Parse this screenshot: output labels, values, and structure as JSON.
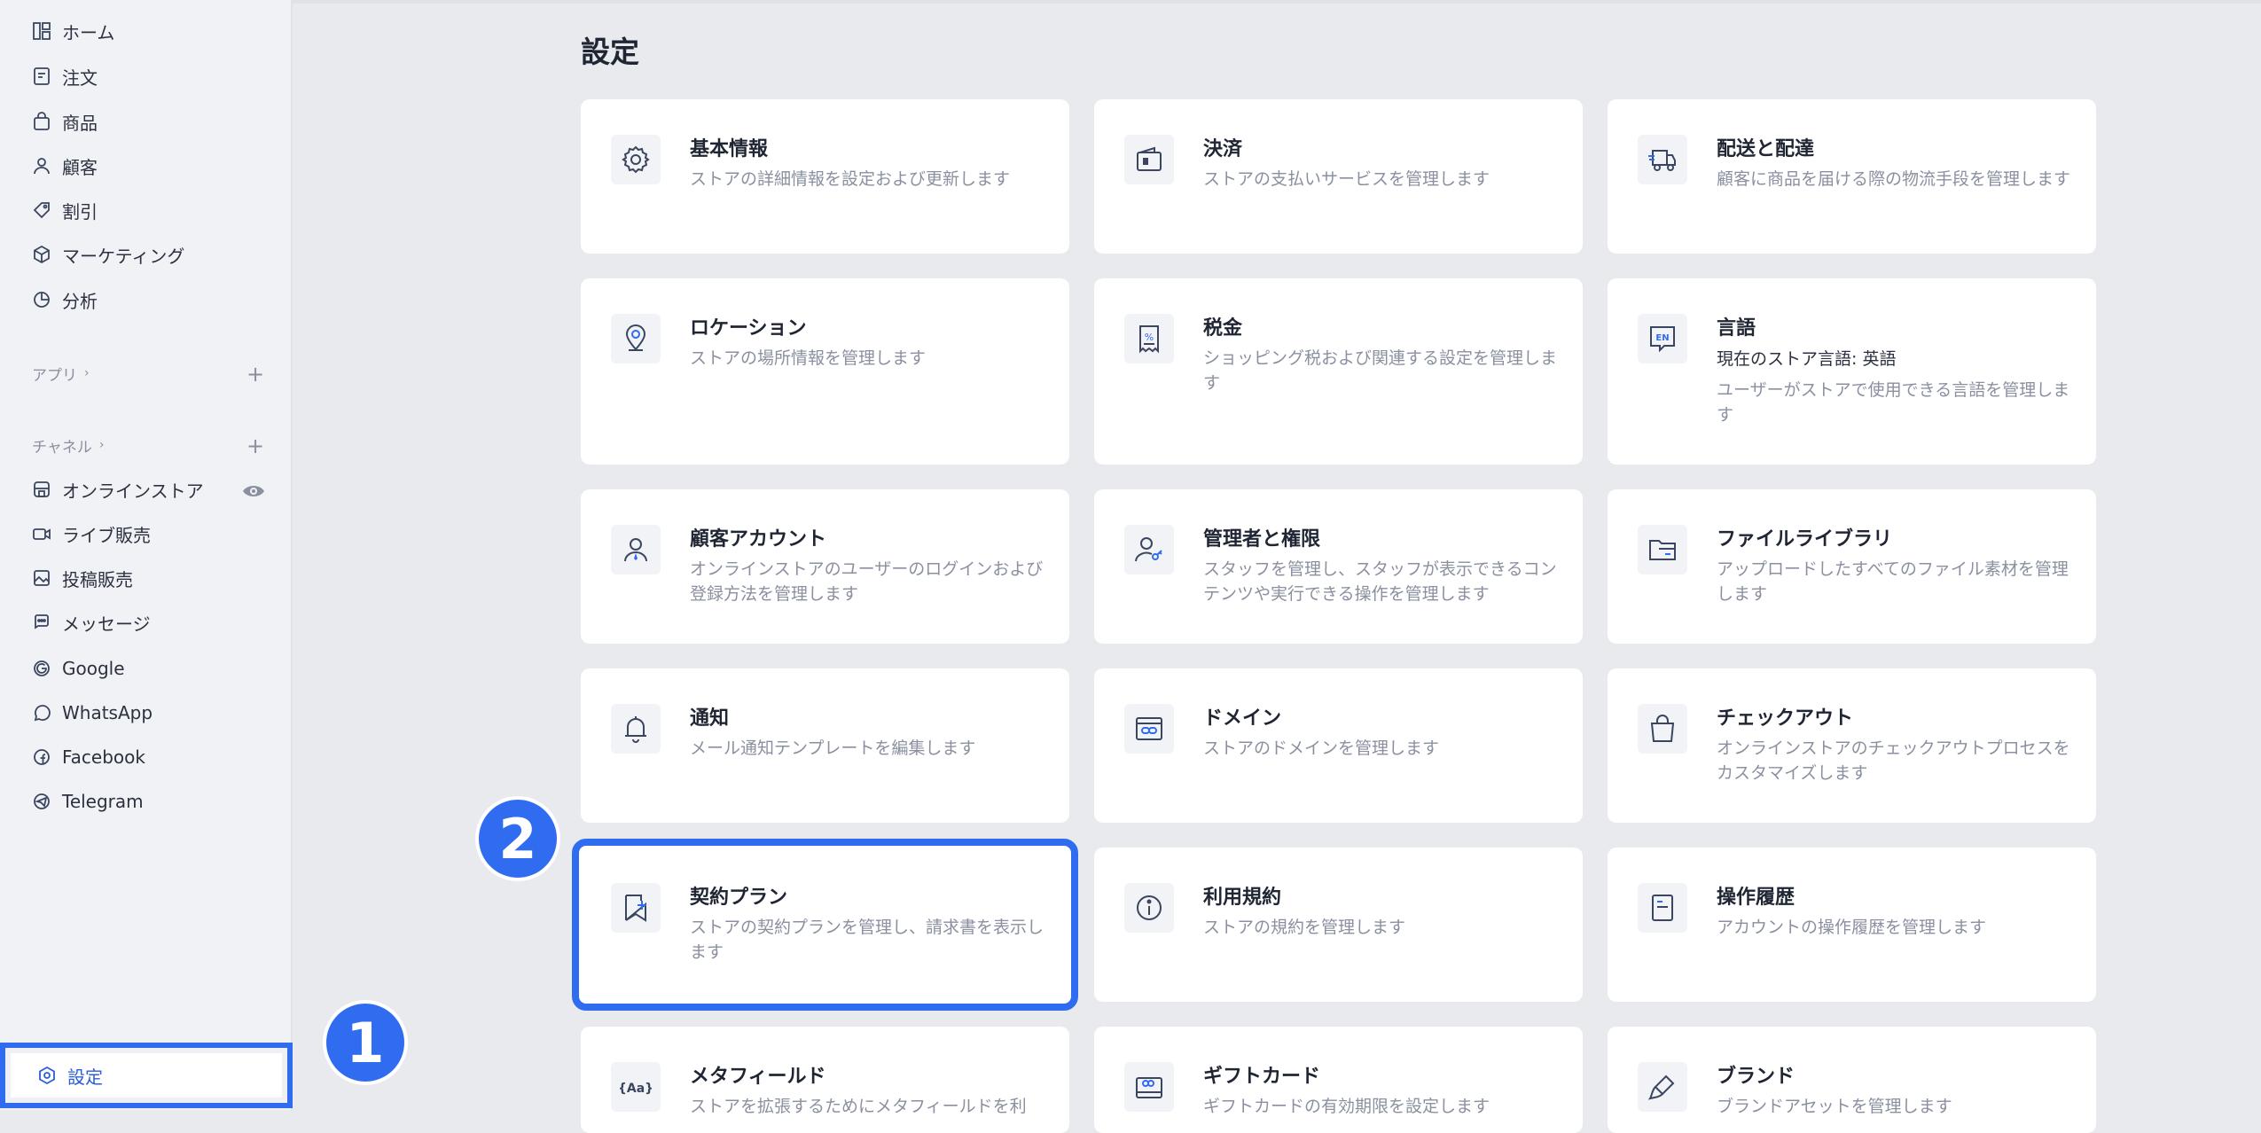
{
  "sidebar": {
    "items": [
      {
        "label": "ホーム",
        "icon": "home-icon"
      },
      {
        "label": "注文",
        "icon": "orders-icon"
      },
      {
        "label": "商品",
        "icon": "products-icon"
      },
      {
        "label": "顧客",
        "icon": "customers-icon"
      },
      {
        "label": "割引",
        "icon": "discount-icon"
      },
      {
        "label": "マーケティング",
        "icon": "marketing-icon"
      },
      {
        "label": "分析",
        "icon": "analytics-icon"
      }
    ],
    "apps_label": "アプリ",
    "channels_label": "チャネル",
    "channels": [
      {
        "label": "オンラインストア",
        "icon": "store-icon"
      },
      {
        "label": "ライブ販売",
        "icon": "live-icon"
      },
      {
        "label": "投稿販売",
        "icon": "post-icon"
      },
      {
        "label": "メッセージ",
        "icon": "message-icon"
      },
      {
        "label": "Google",
        "icon": "google-icon"
      },
      {
        "label": "WhatsApp",
        "icon": "whatsapp-icon"
      },
      {
        "label": "Facebook",
        "icon": "facebook-icon"
      },
      {
        "label": "Telegram",
        "icon": "telegram-icon"
      }
    ],
    "settings_label": "設定"
  },
  "badges": {
    "one": "1",
    "two": "2"
  },
  "main": {
    "title": "設定",
    "cards": [
      {
        "title": "基本情報",
        "desc": "ストアの詳細情報を設定および更新します",
        "icon": "gear-icon"
      },
      {
        "title": "決済",
        "desc": "ストアの支払いサービスを管理します",
        "icon": "wallet-icon"
      },
      {
        "title": "配送と配達",
        "desc": "顧客に商品を届ける際の物流手段を管理します",
        "icon": "truck-icon"
      },
      {
        "title": "ロケーション",
        "desc": "ストアの場所情報を管理します",
        "icon": "location-icon"
      },
      {
        "title": "税金",
        "desc": "ショッピング税および関連する設定を管理します",
        "icon": "tax-icon"
      },
      {
        "title": "言語",
        "sub": "現在のストア言語: 英語",
        "desc": "ユーザーがストアで使用できる言語を管理します",
        "icon": "language-icon",
        "badge": "EN"
      },
      {
        "title": "顧客アカウント",
        "desc": "オンラインストアのユーザーのログインおよび登録方法を管理します",
        "icon": "customer-account-icon"
      },
      {
        "title": "管理者と権限",
        "desc": "スタッフを管理し、スタッフが表示できるコンテンツや実行できる操作を管理します",
        "icon": "admin-icon"
      },
      {
        "title": "ファイルライブラリ",
        "desc": "アップロードしたすべてのファイル素材を管理します",
        "icon": "folder-icon"
      },
      {
        "title": "通知",
        "desc": "メール通知テンプレートを編集します",
        "icon": "bell-icon"
      },
      {
        "title": "ドメイン",
        "desc": "ストアのドメインを管理します",
        "icon": "domain-icon"
      },
      {
        "title": "チェックアウト",
        "desc": "オンラインストアのチェックアウトプロセスをカスタマイズします",
        "icon": "checkout-icon"
      },
      {
        "title": "契約プラン",
        "desc": "ストアの契約プランを管理し、請求書を表示します",
        "icon": "plan-icon"
      },
      {
        "title": "利用規約",
        "desc": "ストアの規約を管理します",
        "icon": "info-icon"
      },
      {
        "title": "操作履歴",
        "desc": "アカウントの操作履歴を管理します",
        "icon": "history-icon"
      },
      {
        "title": "メタフィールド",
        "desc": "ストアを拡張するためにメタフィールドを利",
        "icon": "metafield-icon",
        "badge": "{Aa}"
      },
      {
        "title": "ギフトカード",
        "desc": "ギフトカードの有効期限を設定します",
        "icon": "giftcard-icon"
      },
      {
        "title": "ブランド",
        "desc": "ブランドアセットを管理します",
        "icon": "brand-icon"
      }
    ]
  },
  "colors": {
    "accent": "#2f6cf0",
    "icon": "#3a4660",
    "muted": "#8a90a0"
  }
}
